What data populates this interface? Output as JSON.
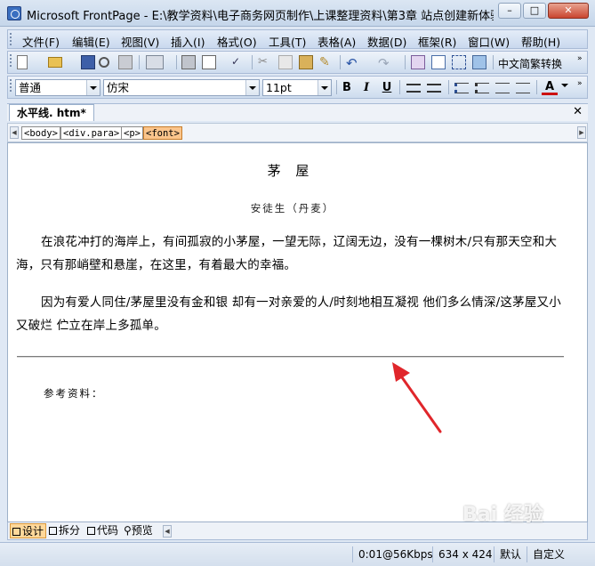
{
  "window": {
    "title": "Microsoft FrontPage - E:\\教学资料\\电子商务网页制作\\上课整理资料\\第3章 站点创建新体验\\水..."
  },
  "menu": [
    "文件(F)",
    "编辑(E)",
    "视图(V)",
    "插入(I)",
    "格式(O)",
    "工具(T)",
    "表格(A)",
    "数据(D)",
    "框架(R)",
    "窗口(W)",
    "帮助(H)"
  ],
  "toolbar": {
    "convert_label": "中文简繁转换"
  },
  "format": {
    "style": "普通",
    "font": "仿宋",
    "size": "11pt",
    "bold": "B",
    "italic": "I",
    "underline": "U",
    "font_color_label": "A"
  },
  "doc_tab": {
    "label": "水平线. htm*"
  },
  "tags": [
    "<body>",
    "<div.para>",
    "<p>",
    "<font>"
  ],
  "document": {
    "title": "茅 屋",
    "author": "安徒生（丹麦）",
    "para1": "在浪花冲打的海岸上，有间孤寂的小茅屋，一望无际，辽阔无边，没有一棵树木/只有那天空和大海，只有那峭壁和悬崖，在这里，有着最大的幸福。",
    "para2": "因为有爱人同住/茅屋里没有金和银 却有一对亲爱的人/时刻地相互凝视 他们多么情深/这茅屋又小又破烂 伫立在岸上多孤单。",
    "reference": "参考资料："
  },
  "views": {
    "design": "设计",
    "split": "拆分",
    "code": "代码",
    "preview": "预览"
  },
  "status": {
    "speed": "0:01@56Kbps",
    "dimensions": "634 x 424",
    "default": "默认",
    "custom": "自定义"
  },
  "watermark": "Bai 经验",
  "annotation_color": "#e0262b"
}
